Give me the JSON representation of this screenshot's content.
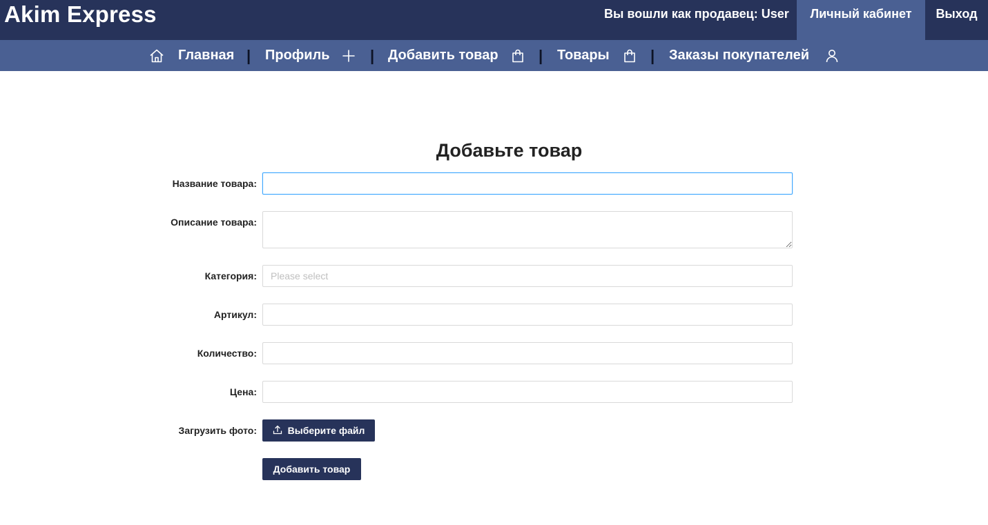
{
  "header": {
    "brand": "Akim Express",
    "seller_info": "Вы вошли как продавец: User",
    "cabinet_label": "Личный кабинет",
    "logout_label": "Выход"
  },
  "nav": {
    "separator": "|",
    "items": [
      {
        "label": "Главная",
        "icon": "home-icon"
      },
      {
        "label": "Профиль",
        "icon": "plus-icon"
      },
      {
        "label": "Добавить товар",
        "icon": "shopping-bag-icon"
      },
      {
        "label": "Товары",
        "icon": "shopping-bag-icon"
      },
      {
        "label": "Заказы покупателей",
        "icon": "user-icon"
      }
    ]
  },
  "form": {
    "title": "Добавьте товар",
    "fields": {
      "name": {
        "label": "Название товара",
        "value": ""
      },
      "description": {
        "label": "Описание товара",
        "value": ""
      },
      "category": {
        "label": "Категория",
        "placeholder": "Please select"
      },
      "article": {
        "label": "Артикул",
        "value": ""
      },
      "quantity": {
        "label": "Количество",
        "value": ""
      },
      "price": {
        "label": "Цена",
        "value": ""
      },
      "photo": {
        "label": "Загрузить фото",
        "button_label": "Выберите файл",
        "icon": "upload-icon"
      }
    },
    "label_suffix": ":",
    "submit_label": "Добавить товар",
    "colors": {
      "primary": "#27335a",
      "nav": "#4a6093",
      "focus_border": "#40a9ff"
    }
  }
}
